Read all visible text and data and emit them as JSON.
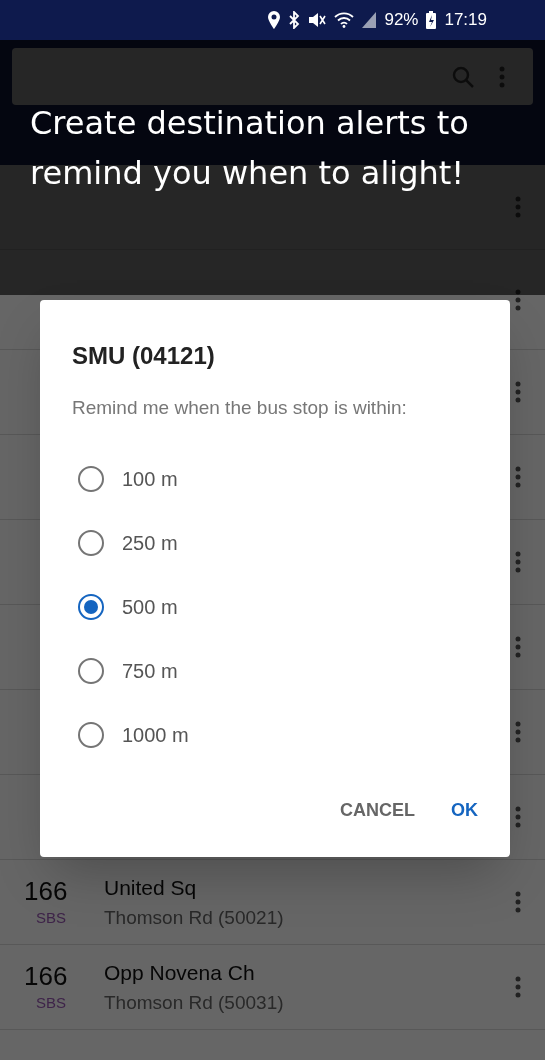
{
  "status_bar": {
    "battery": "92%",
    "time": "17:19"
  },
  "bottom_rows": [
    {
      "route": "166",
      "operator": "SBS",
      "name": "United Sq",
      "stop": "Thomson Rd (50021)"
    },
    {
      "route": "166",
      "operator": "SBS",
      "name": "Opp Novena Ch",
      "stop": "Thomson Rd (50031)"
    }
  ],
  "coach_mark": {
    "text": "Create destination alerts to remind you when to alight!"
  },
  "dialog": {
    "title": "SMU (04121)",
    "message": "Remind me when the bus stop is within:",
    "options": [
      {
        "label": "100 m",
        "selected": false
      },
      {
        "label": "250 m",
        "selected": false
      },
      {
        "label": "500 m",
        "selected": true
      },
      {
        "label": "750 m",
        "selected": false
      },
      {
        "label": "1000 m",
        "selected": false
      }
    ],
    "buttons": [
      {
        "label": "CANCEL",
        "kind": "secondary"
      },
      {
        "label": "OK",
        "kind": "primary"
      }
    ]
  }
}
